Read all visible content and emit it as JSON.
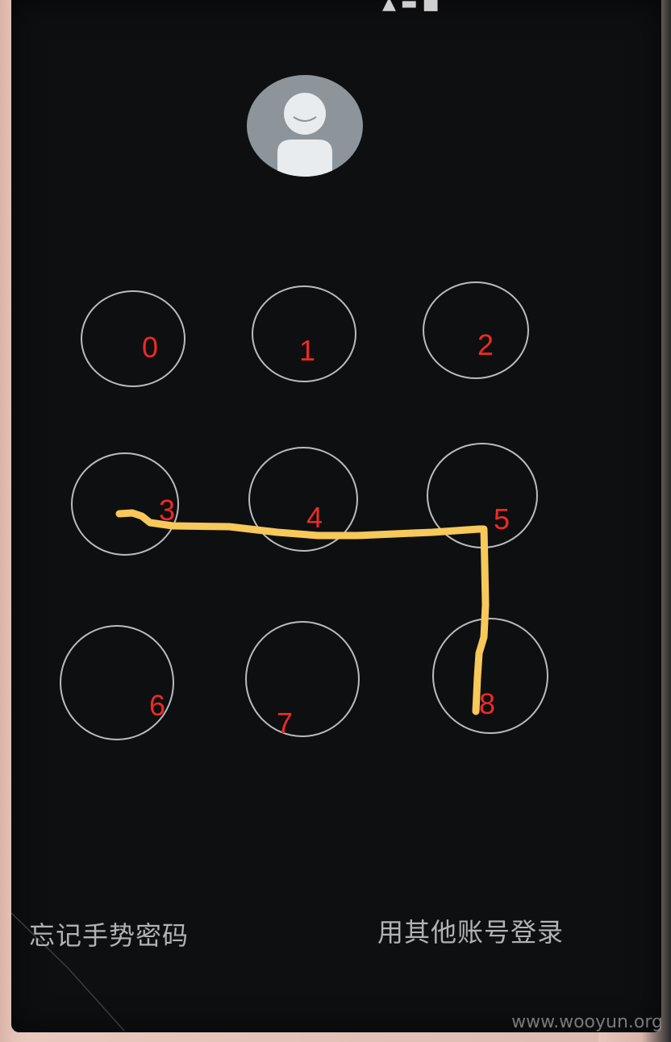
{
  "status_bar": {
    "icons": [
      "signal-icon",
      "wifi-icon",
      "battery-icon"
    ]
  },
  "avatar": {
    "icon": "user-avatar-icon"
  },
  "gesture_lock": {
    "digits": [
      "0",
      "1",
      "2",
      "3",
      "4",
      "5",
      "6",
      "7",
      "8"
    ],
    "drawn_pattern": [
      "3",
      "4",
      "5",
      "8"
    ],
    "digit_color": "#ee2a24",
    "pattern_color": "#f7c85a"
  },
  "links": {
    "forgot_gesture": "忘记手势密码",
    "other_account": "用其他账号登录"
  },
  "watermark": "www.wooyun.org"
}
